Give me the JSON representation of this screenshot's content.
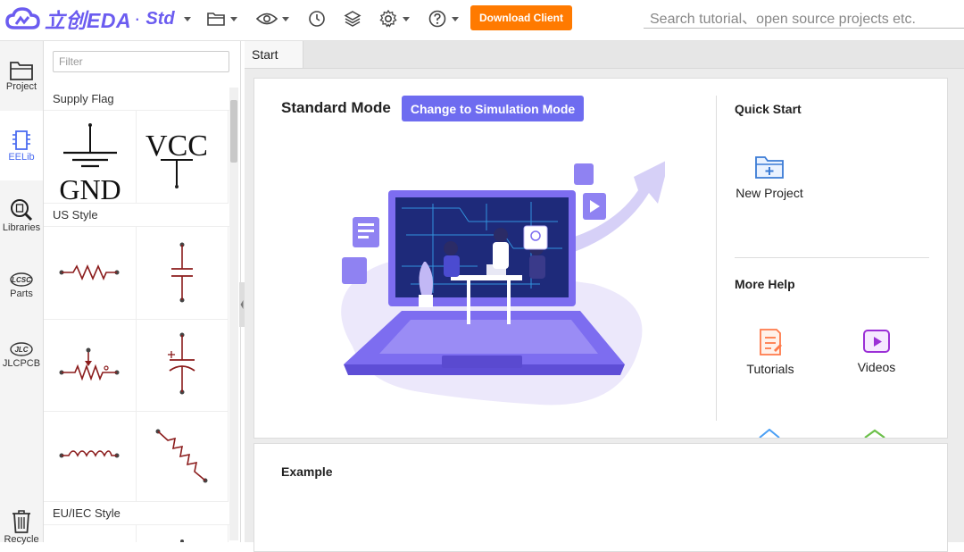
{
  "app": {
    "logo_text": "立创EDA",
    "logo_dot": "·",
    "edition": "Std"
  },
  "toolbar": {
    "icons": [
      "folder-icon",
      "eye-icon",
      "history-icon",
      "layers-icon",
      "gear-icon",
      "help-icon"
    ],
    "download_label": "Download Client",
    "download_color": "#ff7a00",
    "search_placeholder": "Search tutorial、open source projects etc."
  },
  "rail": {
    "items": [
      {
        "label": "Project",
        "icon": "project-folder-icon"
      },
      {
        "label": "EELib",
        "icon": "eelib-chip-icon",
        "active": true
      },
      {
        "label": "Libraries",
        "icon": "libraries-search-icon"
      },
      {
        "label": "Parts",
        "icon": "lcsc-parts-icon"
      },
      {
        "label": "JLCPCB",
        "icon": "jlc-icon"
      },
      {
        "label": "Recycle",
        "icon": "recycle-bin-icon"
      }
    ],
    "active_color": "#4b6cf0"
  },
  "library": {
    "filter_placeholder": "Filter",
    "sections": [
      {
        "title": "Supply Flag",
        "symbols": [
          "GND",
          "VCC"
        ]
      },
      {
        "title": "US Style",
        "symbols": [
          "resistor",
          "capacitor",
          "potentiometer",
          "polarized-capacitor",
          "inductor",
          "variable-resistor"
        ]
      },
      {
        "title": "EU/IEC Style",
        "symbols": []
      }
    ]
  },
  "tabs": [
    {
      "label": "Start"
    }
  ],
  "start": {
    "mode_title": "Standard Mode",
    "switch_button": "Change to Simulation Mode",
    "accent_color": "#6e6cf0",
    "quick_start_title": "Quick Start",
    "new_project_label": "New Project",
    "more_help_title": "More Help",
    "help_items": [
      {
        "label": "Tutorials",
        "icon": "tutorials-icon",
        "color": "#ff7a4a"
      },
      {
        "label": "Videos",
        "icon": "videos-icon",
        "color": "#9b2fd6"
      }
    ],
    "example_title": "Example"
  }
}
